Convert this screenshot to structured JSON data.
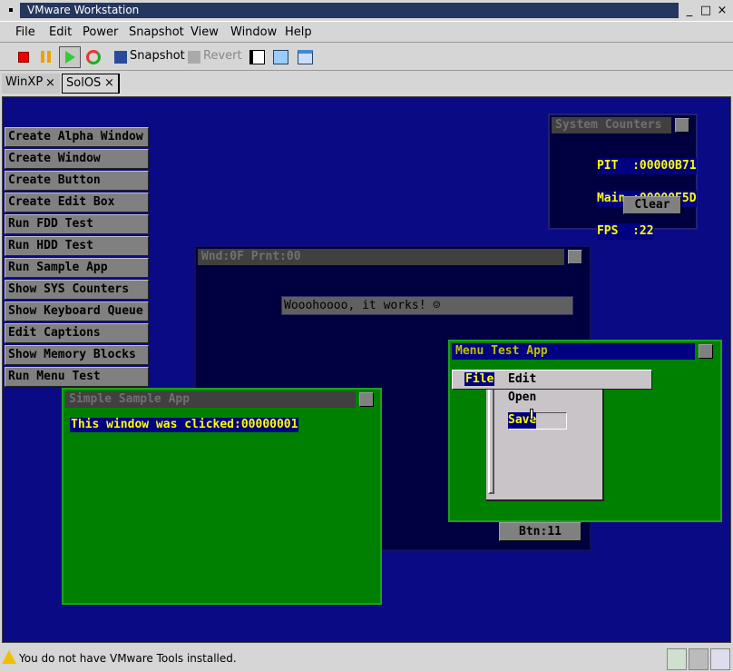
{
  "window": {
    "title": "VMware Workstation",
    "minimize": "_",
    "maximize": "□",
    "close": "×"
  },
  "menu": [
    "File",
    "Edit",
    "Power",
    "Snapshot",
    "View",
    "Window",
    "Help"
  ],
  "toolbar": {
    "snapshot": "Snapshot",
    "revert": "Revert"
  },
  "tabs": [
    {
      "label": "WinXP",
      "close": "×"
    },
    {
      "label": "SolOS",
      "close": "×"
    }
  ],
  "guest": {
    "buttons": [
      "Create Alpha Window",
      "Create Window",
      "Create Button",
      "Create Edit Box",
      "Run FDD Test",
      "Run HDD Test",
      "Run Sample App",
      "Show SYS Counters",
      "Show Keyboard Queue",
      "Edit Captions",
      "Show Memory Blocks",
      "Run Menu Test"
    ],
    "counters": {
      "title": "System Counters",
      "rows": [
        "PIT  :00000B71",
        "Main :00000E5D",
        "FPS  :22"
      ],
      "clear": "Clear"
    },
    "wnd": {
      "title": "Wnd:0F Prnt:00",
      "text": "Wooohoooo, it works! ☺",
      "button": "Btn:11"
    },
    "menu_app": {
      "title": "Menu Test App",
      "menubar": [
        "File",
        "Edit"
      ],
      "dropdown": [
        "Open",
        "Save"
      ]
    },
    "sample_app": {
      "title": "Simple Sample App",
      "text": "This window was clicked:00000001"
    }
  },
  "status": {
    "message": "You do not have VMware Tools installed."
  },
  "colors": {
    "desktop": "#0a0a84",
    "green": "#008000",
    "yellow": "#ffff00",
    "navy": "#000080"
  }
}
